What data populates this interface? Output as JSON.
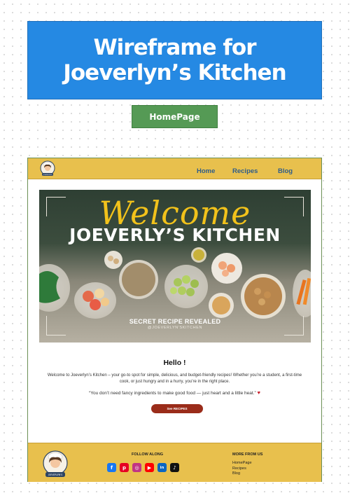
{
  "header": {
    "title_line1": "Wireframe for",
    "title_line2": "Joeverlyn’s Kitchen",
    "page_tag": "HomePage"
  },
  "nav": {
    "logo_text": "JOEVERLYN'S",
    "links": [
      {
        "label": "Home"
      },
      {
        "label": "Recipes"
      },
      {
        "label": "Blog"
      }
    ]
  },
  "hero": {
    "welcome": "Welcome",
    "brand": "JOEVERLY’S KITCHEN",
    "tagline": "SECRET RECIPE REVEALED",
    "handle": "@JOEVERLYN'SKITCHEN"
  },
  "intro": {
    "greeting": "Hello !",
    "body": "Welcome to Joeverlyn’s Kitchen – your go-to spot for simple, delicious, and budget-friendly recipes! Whether you’re a student, a first-time cook, or just hungry and in a hurry, you’re in the right place.",
    "quote": "“You don’t need fancy ingredients to make good food — just heart and a little heat.”",
    "heart": "♥",
    "cta": "See RECIPES"
  },
  "footer": {
    "logo_text": "JOEVERLYN'S",
    "follow_title": "FOLLOW ALONG",
    "socials": [
      {
        "name": "facebook",
        "glyph": "f",
        "color": "#1877f2"
      },
      {
        "name": "pinterest",
        "glyph": "p",
        "color": "#e60023"
      },
      {
        "name": "instagram",
        "glyph": "◎",
        "color": "#c13584"
      },
      {
        "name": "youtube",
        "glyph": "▶",
        "color": "#ff0000"
      },
      {
        "name": "linkedin",
        "glyph": "in",
        "color": "#0a66c2"
      },
      {
        "name": "tiktok",
        "glyph": "♪",
        "color": "#111111"
      }
    ],
    "more_title": "MORE FROM US",
    "more_links": [
      {
        "label": "HomePage"
      },
      {
        "label": "Recipes"
      },
      {
        "label": "Blog"
      }
    ]
  },
  "colors": {
    "title_blue": "#2589e3",
    "tag_green": "#559a55",
    "brand_yellow": "#e8c04d",
    "cta_red": "#9a2c1a",
    "welcome_gold": "#f2c21b"
  }
}
